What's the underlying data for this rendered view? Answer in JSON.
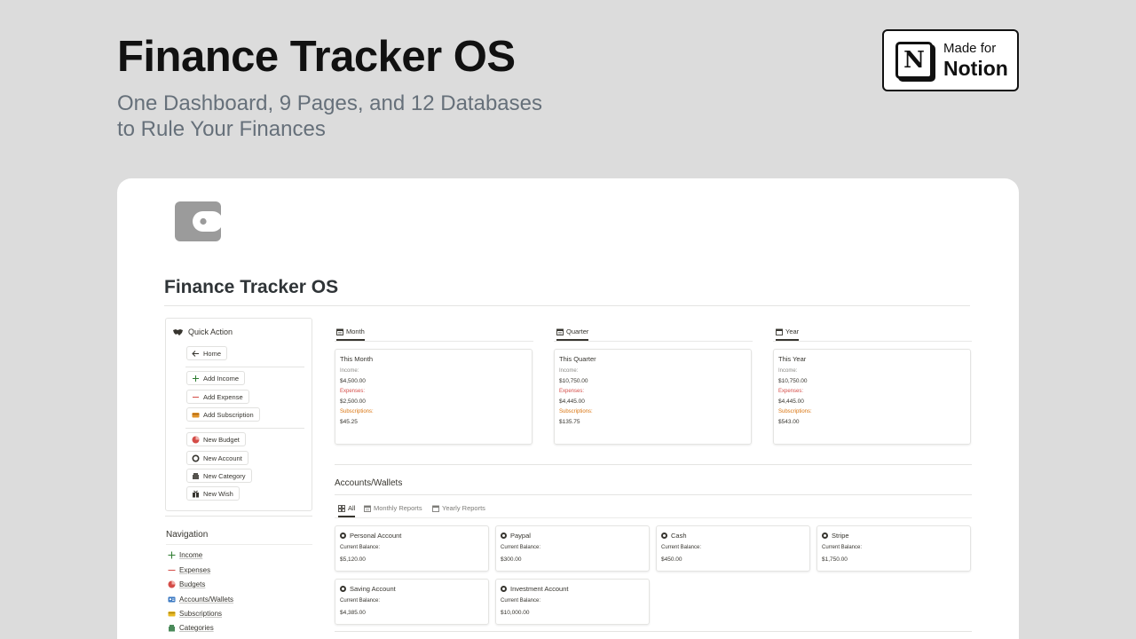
{
  "hero": {
    "title": "Finance Tracker OS",
    "subtitle_line1": "One Dashboard, 9 Pages, and 12 Databases",
    "subtitle_line2": "to Rule Your Finances"
  },
  "badge": {
    "logo_letter": "N",
    "line1": "Made for",
    "line2": "Notion"
  },
  "page": {
    "title": "Finance Tracker OS",
    "icon": "wallet-icon"
  },
  "quick_action": {
    "title": "Quick Action",
    "buttons": [
      {
        "label": "Home",
        "icon": "arrow-left-icon"
      },
      {
        "label": "Add Income",
        "icon": "plus-icon"
      },
      {
        "label": "Add Expense",
        "icon": "minus-icon"
      },
      {
        "label": "Add Subscription",
        "icon": "card-icon"
      },
      {
        "label": "New Budget",
        "icon": "pie-icon"
      },
      {
        "label": "New Account",
        "icon": "circle-icon"
      },
      {
        "label": "New Category",
        "icon": "folder-icon"
      },
      {
        "label": "New Wish",
        "icon": "gift-icon"
      }
    ]
  },
  "navigation": {
    "title": "Navigation",
    "items": [
      {
        "label": "Income",
        "icon": "plus-icon"
      },
      {
        "label": "Expenses",
        "icon": "minus-icon"
      },
      {
        "label": "Budgets",
        "icon": "pie-icon"
      },
      {
        "label": "Accounts/Wallets",
        "icon": "id-card-icon"
      },
      {
        "label": "Subscriptions",
        "icon": "card-icon"
      },
      {
        "label": "Categories",
        "icon": "folder-icon"
      }
    ]
  },
  "periods": [
    {
      "tab": "Month",
      "card_title": "This Month",
      "income_label": "Income:",
      "income": "$4,500.00",
      "expenses_label": "Expenses:",
      "expenses": "$2,500.00",
      "subs_label": "Subscriptions:",
      "subs": "$45.25"
    },
    {
      "tab": "Quarter",
      "card_title": "This Quarter",
      "income_label": "Income:",
      "income": "$10,750.00",
      "expenses_label": "Expenses:",
      "expenses": "$4,445.00",
      "subs_label": "Subscriptions:",
      "subs": "$135.75"
    },
    {
      "tab": "Year",
      "card_title": "This Year",
      "income_label": "Income:",
      "income": "$10,750.00",
      "expenses_label": "Expenses:",
      "expenses": "$4,445.00",
      "subs_label": "Subscriptions:",
      "subs": "$543.00"
    }
  ],
  "accounts": {
    "title": "Accounts/Wallets",
    "views": [
      "All",
      "Monthly Reports",
      "Yearly Reports"
    ],
    "balance_label": "Current Balance:",
    "items": [
      {
        "name": "Personal Account",
        "balance": "$5,120.00"
      },
      {
        "name": "Paypal",
        "balance": "$300.00"
      },
      {
        "name": "Cash",
        "balance": "$450.00"
      },
      {
        "name": "Stripe",
        "balance": "$1,750.00"
      },
      {
        "name": "Saving Account",
        "balance": "$4,385.00"
      },
      {
        "name": "Investment Account",
        "balance": "$10,000.00"
      }
    ]
  },
  "colors": {
    "background": "#dcdcdc",
    "expense_red": "#d44c47",
    "subscription_orange": "#d9730d",
    "text": "#37352f"
  }
}
